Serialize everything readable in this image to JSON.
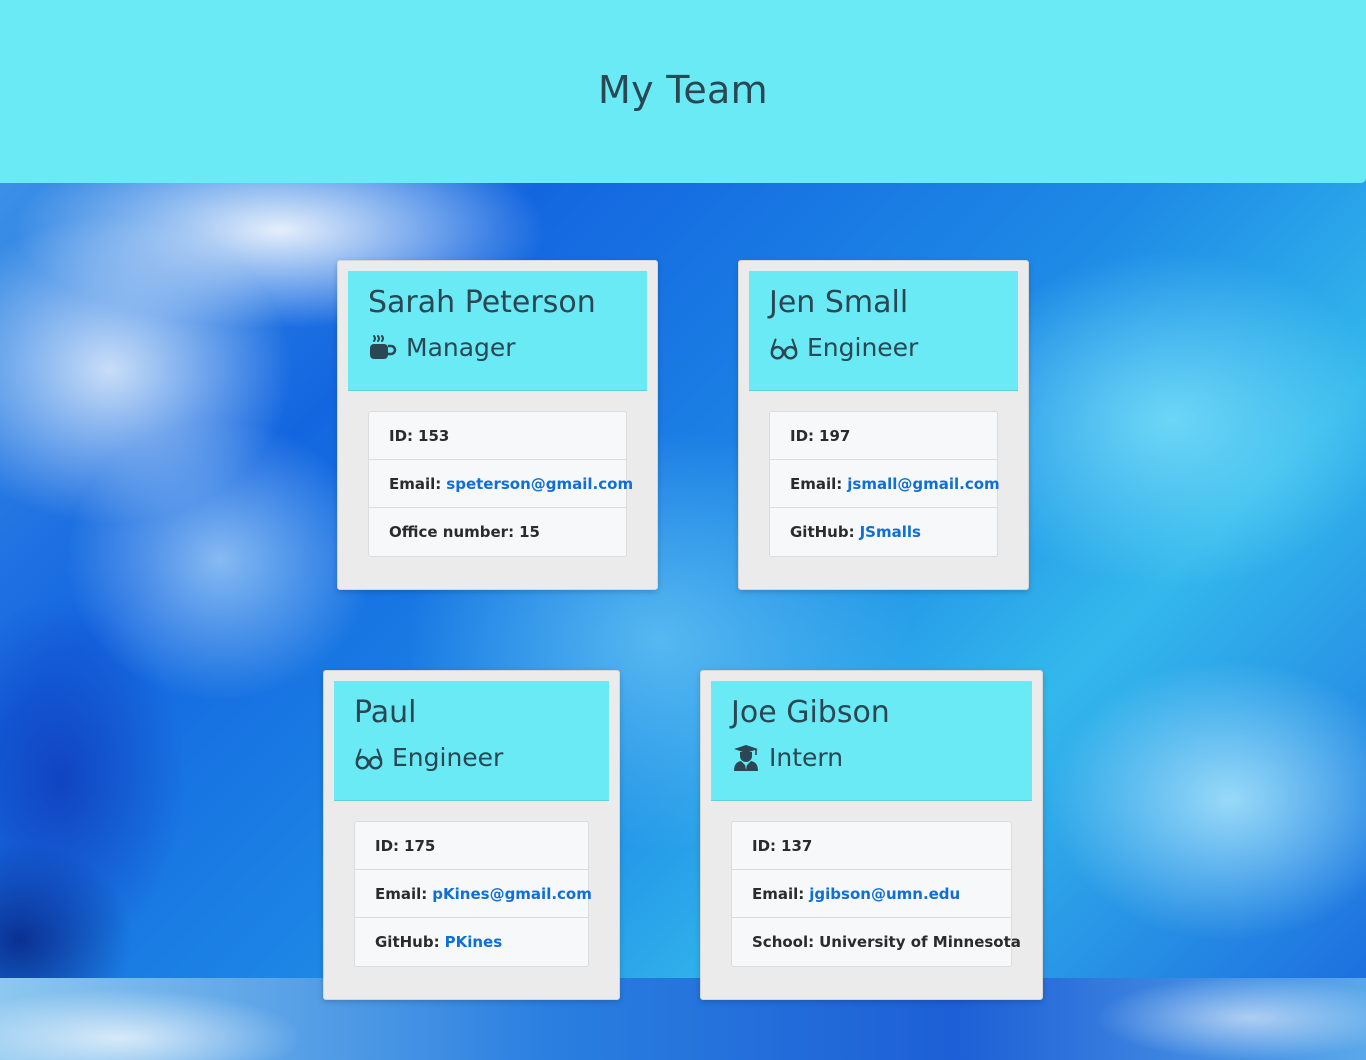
{
  "header": {
    "title": "My Team"
  },
  "team": [
    {
      "name": "Sarah Peterson",
      "role": "Manager",
      "icon": "coffee-mug-icon",
      "id_label": "ID:",
      "id": "153",
      "email_label": "Email:",
      "email": "speterson@gmail.com",
      "extra_label": "Office number:",
      "extra_value": "15"
    },
    {
      "name": "Jen Small",
      "role": "Engineer",
      "icon": "glasses-icon",
      "id_label": "ID:",
      "id": "197",
      "email_label": "Email:",
      "email": "jsmall@gmail.com",
      "extra_label": "GitHub:",
      "extra_value": "JSmalls"
    },
    {
      "name": "Paul",
      "role": "Engineer",
      "icon": "glasses-icon",
      "id_label": "ID:",
      "id": "175",
      "email_label": "Email:",
      "email": "pKines@gmail.com",
      "extra_label": "GitHub:",
      "extra_value": "PKines"
    },
    {
      "name": "Joe Gibson",
      "role": "Intern",
      "icon": "graduate-icon",
      "id_label": "ID:",
      "id": "137",
      "email_label": "Email:",
      "email": "jgibson@umn.edu",
      "extra_label": "School:",
      "extra_value": "University of Minnesota"
    }
  ],
  "colors": {
    "header_bg": "#6aeaf5",
    "title_text": "#2a4753",
    "link": "#0f6fd8",
    "card_bg": "#ebebeb",
    "list_bg": "#f7f8fa"
  }
}
